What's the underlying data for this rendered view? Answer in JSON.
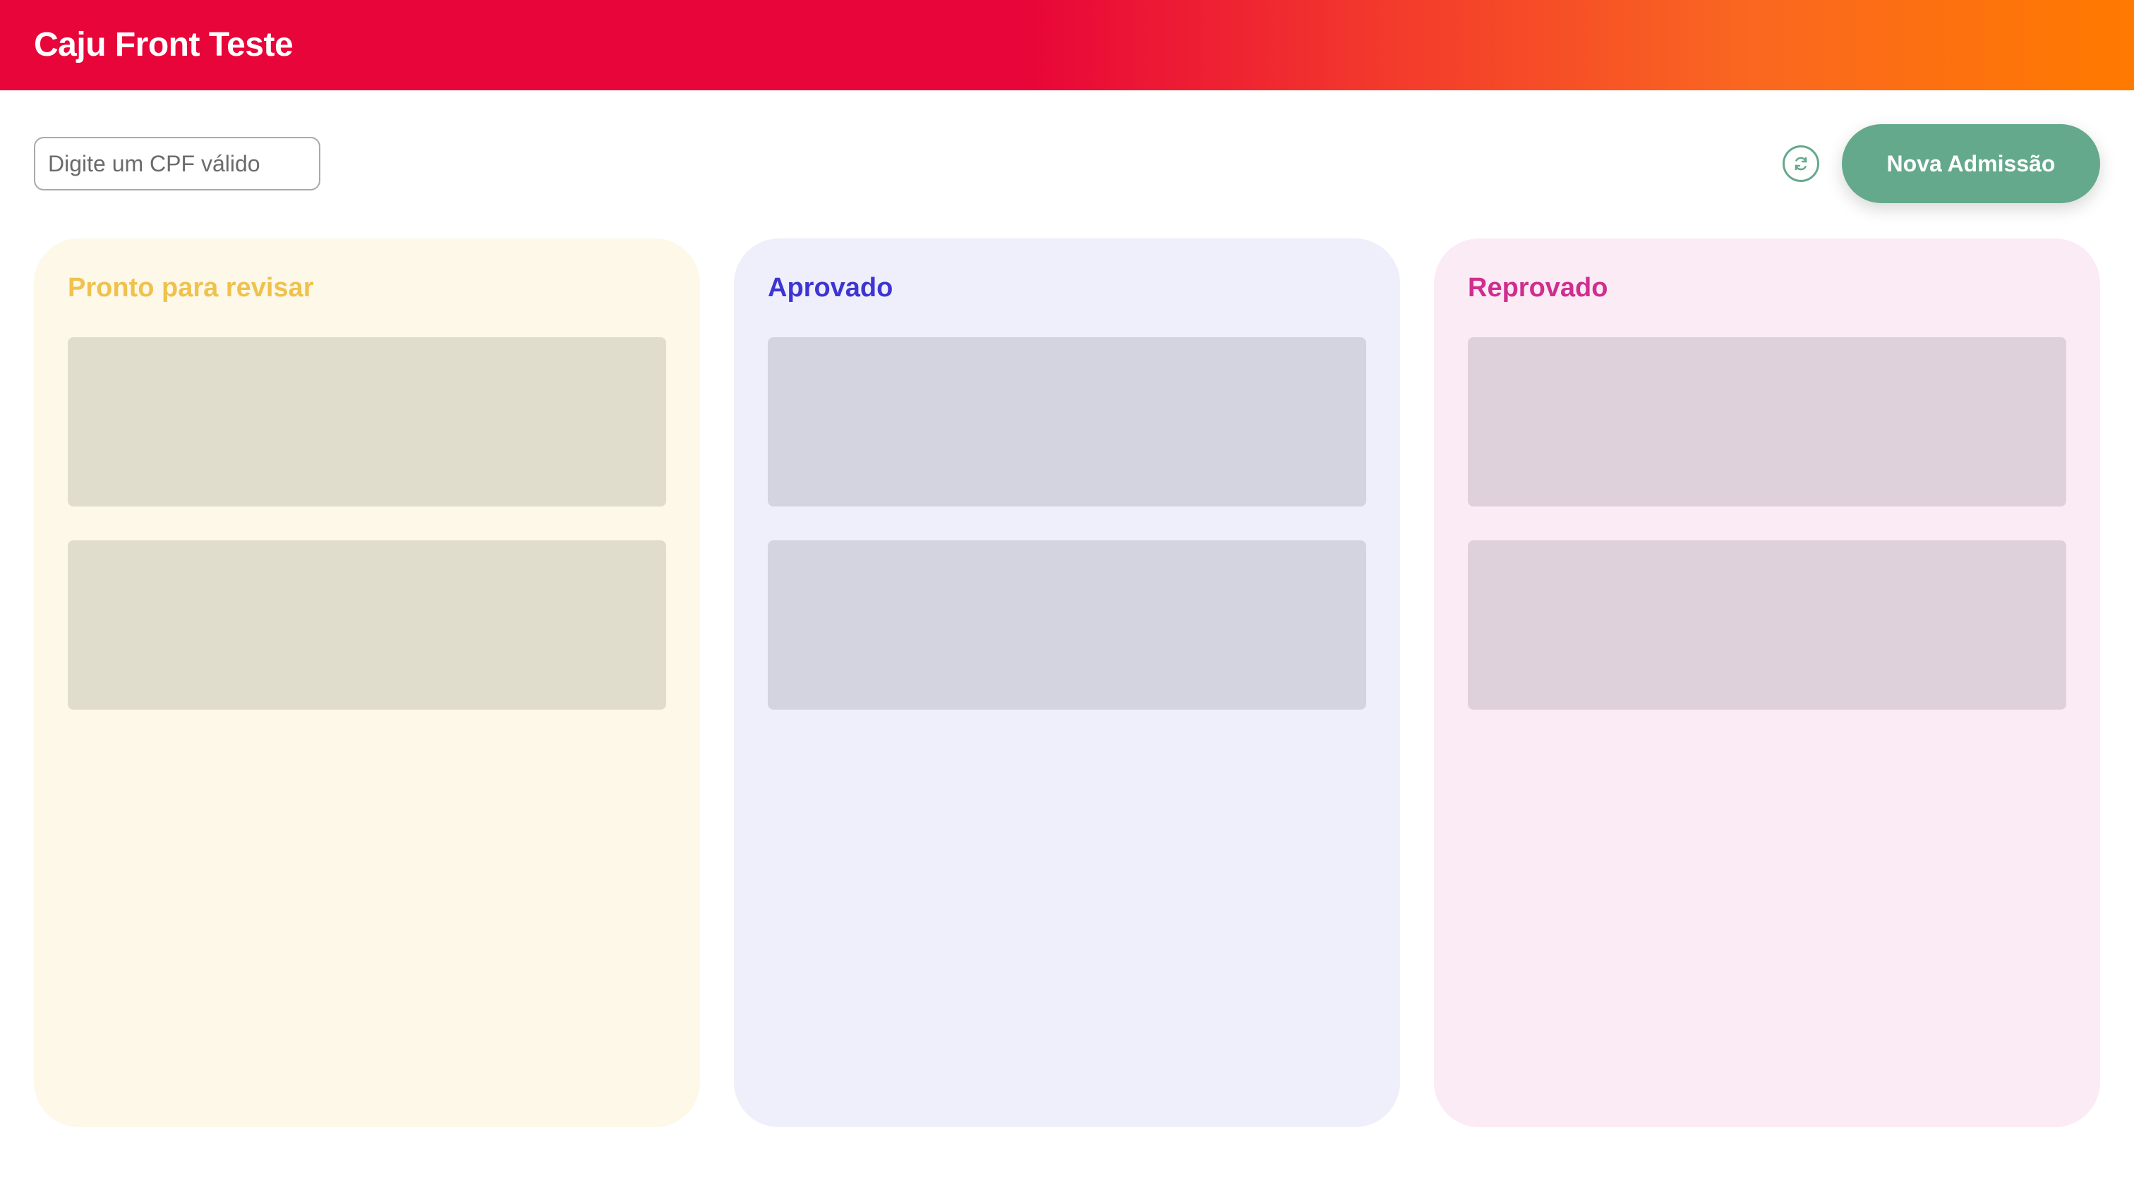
{
  "header": {
    "title": "Caju Front Teste"
  },
  "toolbar": {
    "search_placeholder": "Digite um CPF válido",
    "search_value": "",
    "refresh_icon": "refresh-icon",
    "new_admission_label": "Nova Admissão"
  },
  "columns": [
    {
      "title": "Pronto para revisar",
      "color": "#efc24d",
      "background": "#fdf8e8",
      "loading_cards": 2
    },
    {
      "title": "Aprovado",
      "color": "#3d35d2",
      "background": "#efeefb",
      "loading_cards": 2
    },
    {
      "title": "Reprovado",
      "color": "#cf2e8f",
      "background": "#fbebf4",
      "loading_cards": 2
    }
  ],
  "colors": {
    "header_start": "#e80539",
    "header_end": "#ff7a00",
    "primary_button": "#64a98c"
  }
}
